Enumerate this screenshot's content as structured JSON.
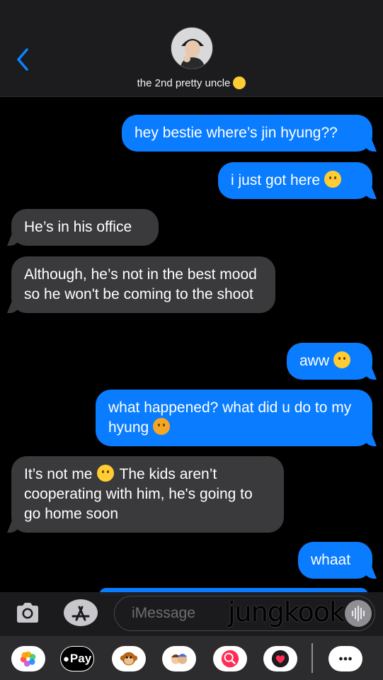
{
  "header": {
    "contact_name": "the 2nd pretty uncle"
  },
  "messages": [
    {
      "side": "sent",
      "text": "hey bestie where’s jin hyung??"
    },
    {
      "side": "sent",
      "text": "i just got here"
    },
    {
      "side": "received",
      "text": "He’s in his office"
    },
    {
      "side": "received",
      "text": "Although, he’s not in the best mood so he won't be coming to the shoot"
    },
    {
      "side": "sent",
      "text": "aww"
    },
    {
      "side": "sent",
      "text": "what happened? what did u do to my hyung"
    },
    {
      "side": "received",
      "text_a": "It’s not me",
      "text_b": "The kids aren’t cooperating with him, he's going to go home soon"
    },
    {
      "side": "sent",
      "text": "whaat"
    }
  ],
  "composer": {
    "placeholder": "iMessage",
    "sticker_text": "jungkook"
  },
  "app_drawer": {
    "applepay_label": "Pay"
  },
  "colors": {
    "sent_bubble": "#0a7cff",
    "received_bubble": "#3a3a3c",
    "accent": "#0a84ff"
  }
}
